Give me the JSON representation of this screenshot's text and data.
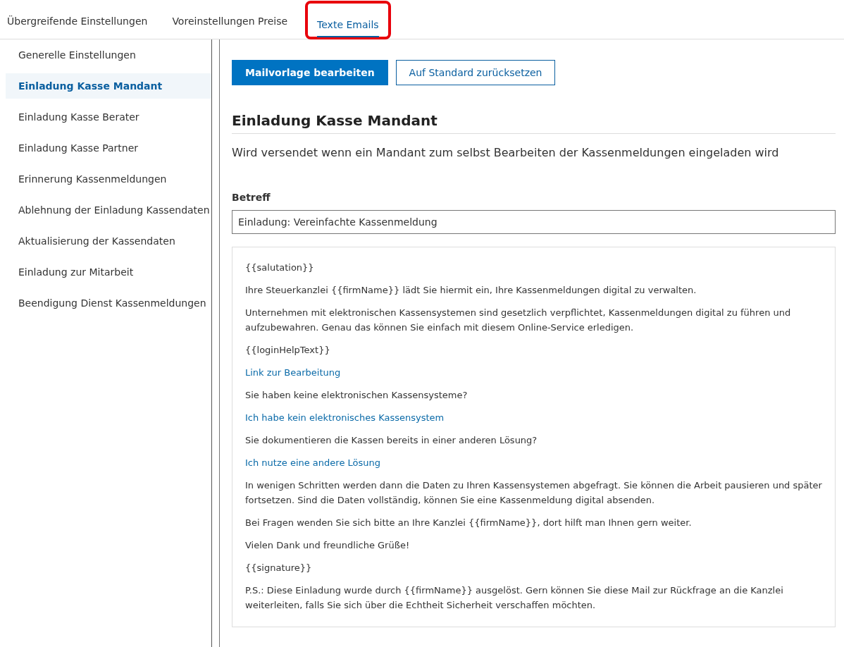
{
  "tabs": [
    {
      "label": "Übergreifende Einstellungen",
      "selected": false,
      "highlighted": false
    },
    {
      "label": "Voreinstellungen Preise",
      "selected": false,
      "highlighted": false
    },
    {
      "label": "Texte Emails",
      "selected": true,
      "highlighted": true
    }
  ],
  "sidebar": {
    "items": [
      {
        "label": "Generelle Einstellungen",
        "selected": false
      },
      {
        "label": "Einladung Kasse Mandant",
        "selected": true
      },
      {
        "label": "Einladung Kasse Berater",
        "selected": false
      },
      {
        "label": "Einladung Kasse Partner",
        "selected": false
      },
      {
        "label": "Erinnerung Kassenmeldungen",
        "selected": false
      },
      {
        "label": "Ablehnung der Einladung Kassendaten",
        "selected": false
      },
      {
        "label": "Aktualisierung der Kassendaten",
        "selected": false
      },
      {
        "label": "Einladung zur Mitarbeit",
        "selected": false
      },
      {
        "label": "Beendigung Dienst Kassenmeldungen",
        "selected": false
      }
    ]
  },
  "toolbar": {
    "primary_button": "Mailvorlage bearbeiten",
    "secondary_button": "Auf Standard zurücksetzen"
  },
  "template": {
    "title": "Einladung Kasse Mandant",
    "description": "Wird versendet wenn ein Mandant zum selbst Bearbeiten der Kassenmeldungen eingeladen wird",
    "subject_label": "Betreff",
    "subject_value": "Einladung: Vereinfachte Kassenmeldung",
    "body": [
      {
        "kind": "text",
        "text": "{{salutation}}"
      },
      {
        "kind": "text",
        "text": "Ihre Steuerkanzlei {{firmName}} lädt Sie hiermit ein, Ihre Kassenmeldungen digital zu verwalten."
      },
      {
        "kind": "text",
        "text": "Unternehmen mit elektronischen Kassensystemen sind gesetzlich verpflichtet, Kassenmeldungen digital zu führen und aufzubewahren. Genau das können Sie einfach mit diesem Online-Service erledigen."
      },
      {
        "kind": "text",
        "text": "{{loginHelpText}}"
      },
      {
        "kind": "link",
        "text": "Link zur Bearbeitung"
      },
      {
        "kind": "text",
        "text": "Sie haben keine elektronischen Kassensysteme?"
      },
      {
        "kind": "link",
        "text": "Ich habe kein elektronisches Kassensystem"
      },
      {
        "kind": "text",
        "text": "Sie dokumentieren die Kassen bereits in einer anderen Lösung?"
      },
      {
        "kind": "link",
        "text": "Ich nutze eine andere Lösung"
      },
      {
        "kind": "text",
        "text": "In wenigen Schritten werden dann die Daten zu Ihren Kassensystemen abgefragt. Sie können die Arbeit pausieren und später fortsetzen. Sind die Daten vollständig, können Sie eine Kassenmeldung digital absenden."
      },
      {
        "kind": "text",
        "text": "Bei Fragen wenden Sie sich bitte an Ihre Kanzlei {{firmName}}, dort hilft man Ihnen gern weiter."
      },
      {
        "kind": "text",
        "text": "Vielen Dank und freundliche Grüße!"
      },
      {
        "kind": "text",
        "text": "{{signature}}"
      },
      {
        "kind": "text",
        "text": "P.S.: Diese Einladung wurde durch {{firmName}} ausgelöst. Gern können Sie diese Mail zur Rückfrage an die Kanzlei weiterleiten, falls Sie sich über die Echtheit Sicherheit verschaffen möchten."
      }
    ]
  }
}
